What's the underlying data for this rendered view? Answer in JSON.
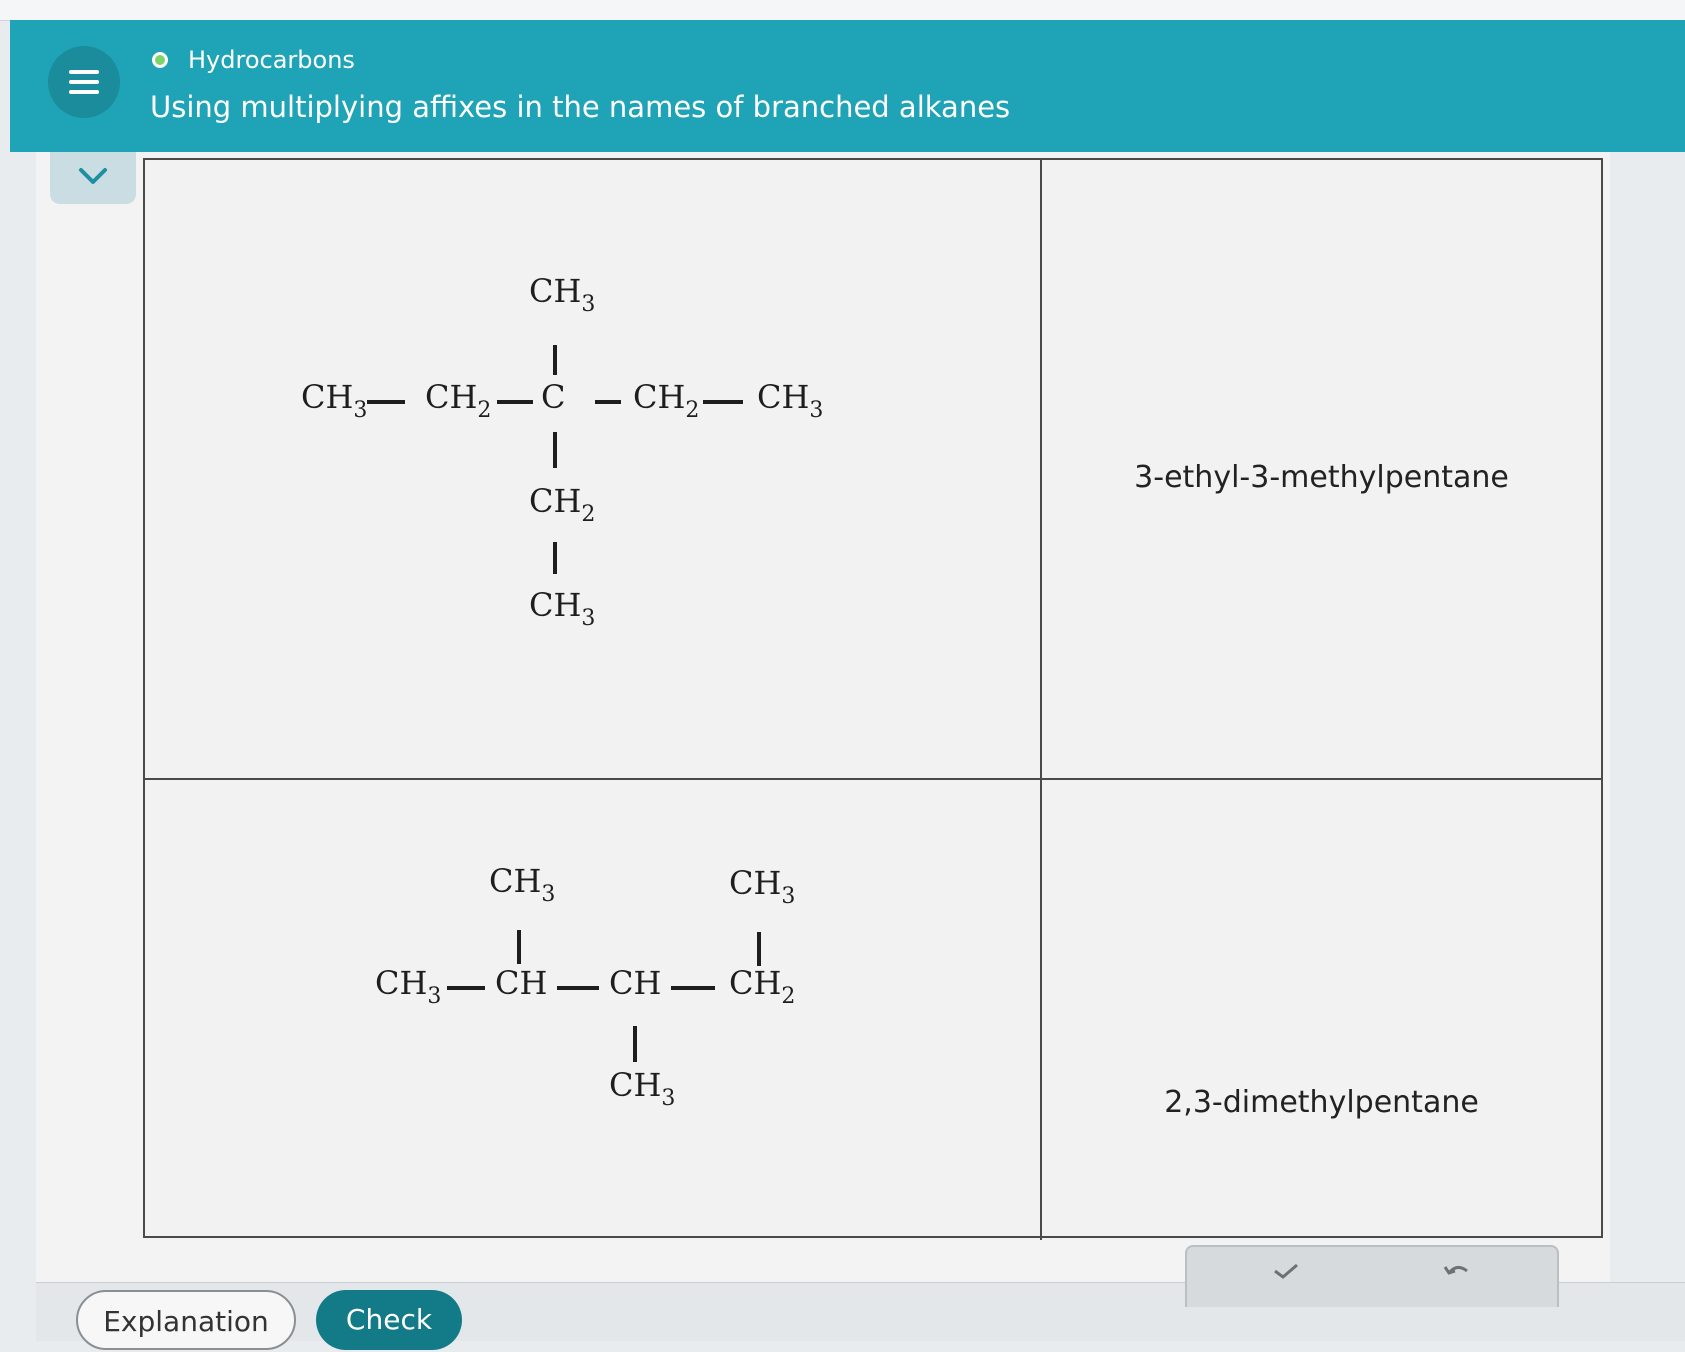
{
  "header": {
    "topic": "Hydrocarbons",
    "title": "Using multiplying affixes in the names of branched alkanes"
  },
  "table": {
    "rows": [
      {
        "formula": {
          "main": [
            "CH",
            "3",
            "CH",
            "2",
            "C",
            "CH",
            "2",
            "CH",
            "3"
          ],
          "top": [
            "CH",
            "3"
          ],
          "bottom1": [
            "CH",
            "2"
          ],
          "bottom2": [
            "CH",
            "3"
          ]
        },
        "name": "3-ethyl-3-methylpentane"
      },
      {
        "formula": {
          "main": [
            "CH",
            "3",
            "CH",
            "CH",
            "CH",
            "2"
          ],
          "top_left": [
            "CH",
            "3"
          ],
          "top_right": [
            "CH",
            "3"
          ],
          "bottom": [
            "CH",
            "3"
          ]
        },
        "name": "2,3-dimethylpentane"
      }
    ]
  },
  "buttons": {
    "explanation": "Explanation",
    "check": "Check"
  },
  "colors": {
    "header": "#1fa3b6",
    "check_button": "#137a88",
    "topic_dot": "#7ed36a"
  }
}
